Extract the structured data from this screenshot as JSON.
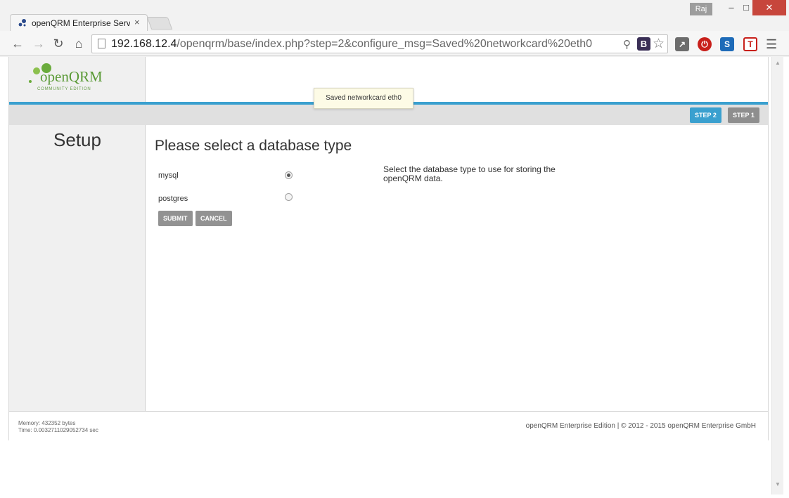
{
  "browser": {
    "tab_title": "openQRM Enterprise Serv",
    "tab_close": "×",
    "user_badge": "Raj",
    "url_host": "192.168.12.4",
    "url_path": "/openqrm/base/index.php?step=2&configure_msg=Saved%20networkcard%20eth0",
    "ext_b_label": "B",
    "ext_s_label": "S",
    "ext_t_label": "T"
  },
  "logo": {
    "name": "openQRM",
    "edition": "COMMUNITY EDITION"
  },
  "notification": "Saved networkcard eth0",
  "steps": {
    "step2": "STEP 2",
    "step1": "STEP 1",
    "active": "STEP 2",
    "active_color": "#3aa0cf"
  },
  "sidebar": {
    "title": "Setup"
  },
  "form": {
    "heading": "Please select a database type",
    "options": [
      {
        "label": "mysql",
        "selected": true
      },
      {
        "label": "postgres",
        "selected": false
      }
    ],
    "help": "Select the database type to use for storing the openQRM data.",
    "submit": "SUBMIT",
    "cancel": "CANCEL"
  },
  "footer": {
    "memory": "Memory: 432352 bytes",
    "time": "Time: 0.0032711029052734 sec",
    "copyright": "openQRM Enterprise Edition | © 2012 - 2015 openQRM Enterprise GmbH"
  }
}
